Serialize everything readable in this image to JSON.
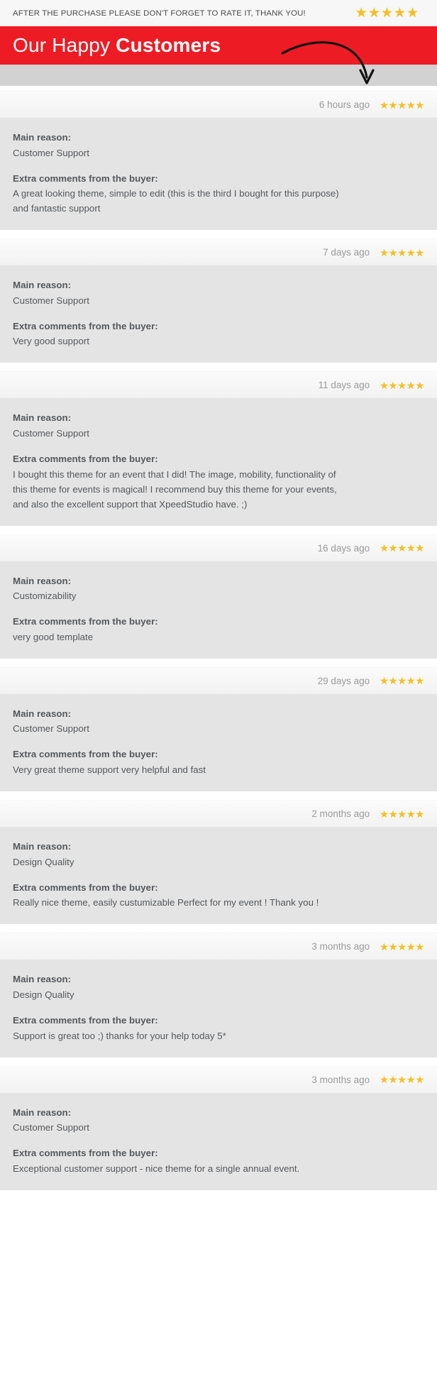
{
  "notice": {
    "text": "AFTER THE PURCHASE PLEASE DON'T FORGET TO RATE IT, THANK YOU!",
    "star_glyph": "★",
    "stars": 5,
    "star_color": "#f5bf23"
  },
  "banner": {
    "title_light": "Our Happy ",
    "title_bold": "Customers",
    "background_color": "#ed1b24",
    "text_color": "#ffffff"
  },
  "labels": {
    "main_reason": "Main reason:",
    "extra_comments": "Extra comments from the buyer:"
  },
  "reviews": [
    {
      "user": "",
      "time": "6 hours ago",
      "stars": 5,
      "main_reason": "Customer Support",
      "comment": "A great looking theme, simple to edit (this is the third I bought for this purpose) and fantastic support"
    },
    {
      "user": "",
      "time": "7 days ago",
      "stars": 5,
      "main_reason": "Customer Support",
      "comment": "Very good support"
    },
    {
      "user": "",
      "time": "11 days ago",
      "stars": 5,
      "main_reason": "Customer Support",
      "comment": "I bought this theme for an event that I did! The image, mobility, functionality of this theme for events is magical! I recommend buy this theme for your events, and also the excellent support that XpeedStudio have. ;)"
    },
    {
      "user": "",
      "time": "16 days ago",
      "stars": 5,
      "main_reason": "Customizability",
      "comment": "very good template"
    },
    {
      "user": "",
      "time": "29 days ago",
      "stars": 5,
      "main_reason": "Customer Support",
      "comment": "Very great theme support very helpful and fast"
    },
    {
      "user": "",
      "time": "2 months ago",
      "stars": 5,
      "main_reason": "Design Quality",
      "comment": "Really nice theme, easily custumizable Perfect for my event ! Thank you !"
    },
    {
      "user": "",
      "time": "3 months ago",
      "stars": 5,
      "main_reason": "Design Quality",
      "comment": "Support is great too ;) thanks for your help today 5*"
    },
    {
      "user": "",
      "time": "3 months ago",
      "stars": 5,
      "main_reason": "Customer Support",
      "comment": "Exceptional customer support - nice theme for a single annual event."
    }
  ]
}
